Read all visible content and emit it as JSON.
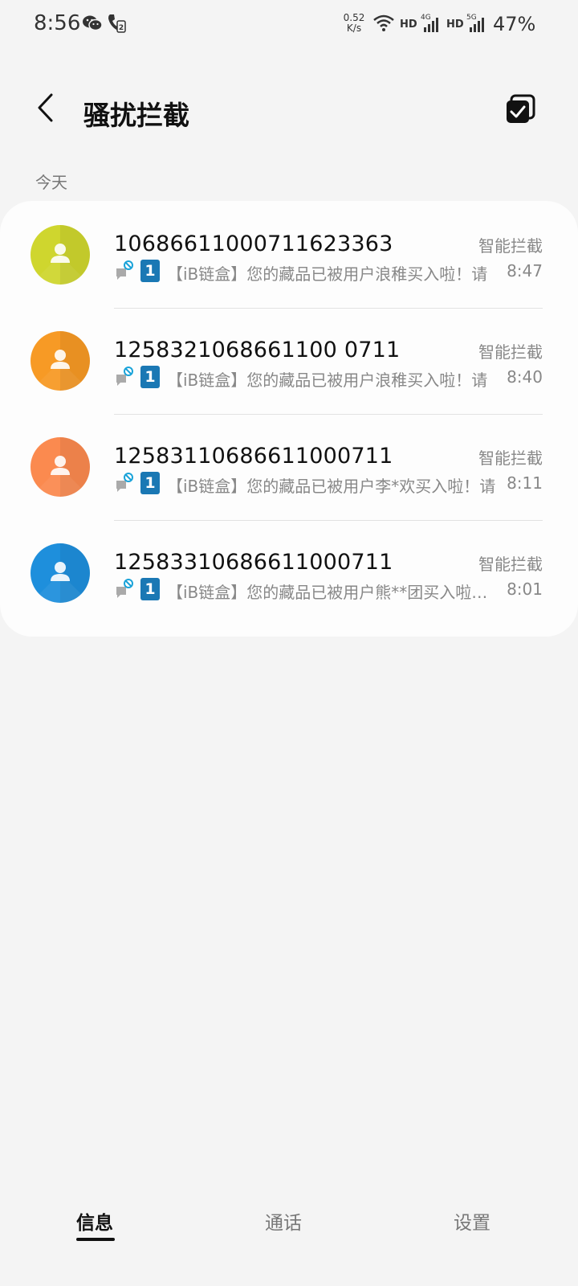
{
  "status_bar": {
    "time": "8:56",
    "net_speed_value": "0.52",
    "net_speed_unit": "K/s",
    "hd1": "HD",
    "hd2": "HD",
    "sig1_label": "4G",
    "sig2_label": "5G",
    "battery": "47%",
    "icons": [
      "wechat-icon",
      "call-icon",
      "wifi-icon",
      "signal-icon",
      "signal-icon"
    ]
  },
  "header": {
    "title": "骚扰拦截",
    "back_icon": "back-arrow-icon",
    "select_icon": "multi-select-icon"
  },
  "section_label": "今天",
  "messages": [
    {
      "sender": "10686611000711623363",
      "tag": "智能拦截",
      "sim": "1",
      "preview": "【iB链盒】您的藏品已被用户浪稚买入啦！请",
      "time": "8:47",
      "avatar_color": "#cfd62e"
    },
    {
      "sender": "1258321068661100 0711",
      "tag": "智能拦截",
      "sim": "1",
      "preview": "【iB链盒】您的藏品已被用户浪稚买入啦！请",
      "time": "8:40",
      "avatar_color": "#f79a25"
    },
    {
      "sender": "12583110686611000711",
      "tag": "智能拦截",
      "sim": "1",
      "preview": "【iB链盒】您的藏品已被用户李*欢买入啦！请",
      "time": "8:11",
      "avatar_color": "#fb8a4f"
    },
    {
      "sender": "12583310686611000711",
      "tag": "智能拦截",
      "sim": "1",
      "preview": "【iB链盒】您的藏品已被用户熊**团买入啦！请",
      "time": "8:01",
      "avatar_color": "#1e8fdc"
    }
  ],
  "bottom_nav": {
    "tabs": [
      "信息",
      "通话",
      "设置"
    ],
    "active_index": 0
  },
  "colors": {
    "background": "#f4f4f4",
    "card": "#fdfdfd",
    "sim_badge": "#1a78b4",
    "blocked_accent": "#1aa3d9"
  }
}
